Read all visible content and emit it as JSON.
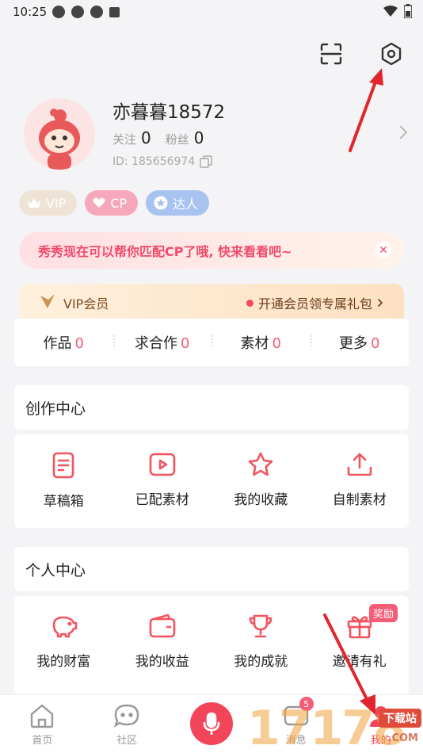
{
  "status_bar": {
    "time": "10:25"
  },
  "profile": {
    "username": "亦暮暮18572",
    "follow_label": "关注",
    "follow_count": "0",
    "fans_label": "粉丝",
    "fans_count": "0",
    "id_text": "ID: 185656974"
  },
  "badges": [
    {
      "label": "VIP"
    },
    {
      "label": "CP"
    },
    {
      "label": "达人"
    }
  ],
  "notice": {
    "text": "秀秀现在可以帮你匹配CP了哦, 快来看看吧~"
  },
  "vip_bar": {
    "left": "VIP会员",
    "right": "开通会员领专属礼包"
  },
  "tabs": [
    {
      "label": "作品",
      "count": "0"
    },
    {
      "label": "求合作",
      "count": "0"
    },
    {
      "label": "素材",
      "count": "0"
    },
    {
      "label": "更多",
      "count": "0"
    }
  ],
  "creation_center": {
    "title": "创作中心",
    "items": [
      {
        "label": "草稿箱",
        "icon": "draft-icon"
      },
      {
        "label": "已配素材",
        "icon": "video-icon"
      },
      {
        "label": "我的收藏",
        "icon": "star-icon"
      },
      {
        "label": "自制素材",
        "icon": "upload-icon"
      }
    ]
  },
  "personal_center": {
    "title": "个人中心",
    "reward_tag": "奖励",
    "items": [
      {
        "label": "我的财富",
        "icon": "piggy-bank-icon"
      },
      {
        "label": "我的收益",
        "icon": "wallet-icon"
      },
      {
        "label": "我的成就",
        "icon": "trophy-icon"
      },
      {
        "label": "邀请有礼",
        "icon": "gift-icon"
      }
    ]
  },
  "bottom_nav": {
    "items": [
      {
        "label": "首页",
        "icon": "home-icon"
      },
      {
        "label": "社区",
        "icon": "community-icon"
      },
      {
        "label": "",
        "icon": "mic-icon"
      },
      {
        "label": "消息",
        "icon": "message-icon",
        "badge": "5"
      },
      {
        "label": "我的",
        "icon": "profile-icon"
      }
    ]
  },
  "watermark": {
    "digits": "17178",
    "tag": "下载站",
    "suffix": ".COM"
  },
  "colors": {
    "accent": "#f45c78",
    "mic": "#f2455a",
    "notice_text": "#f24a6a"
  }
}
